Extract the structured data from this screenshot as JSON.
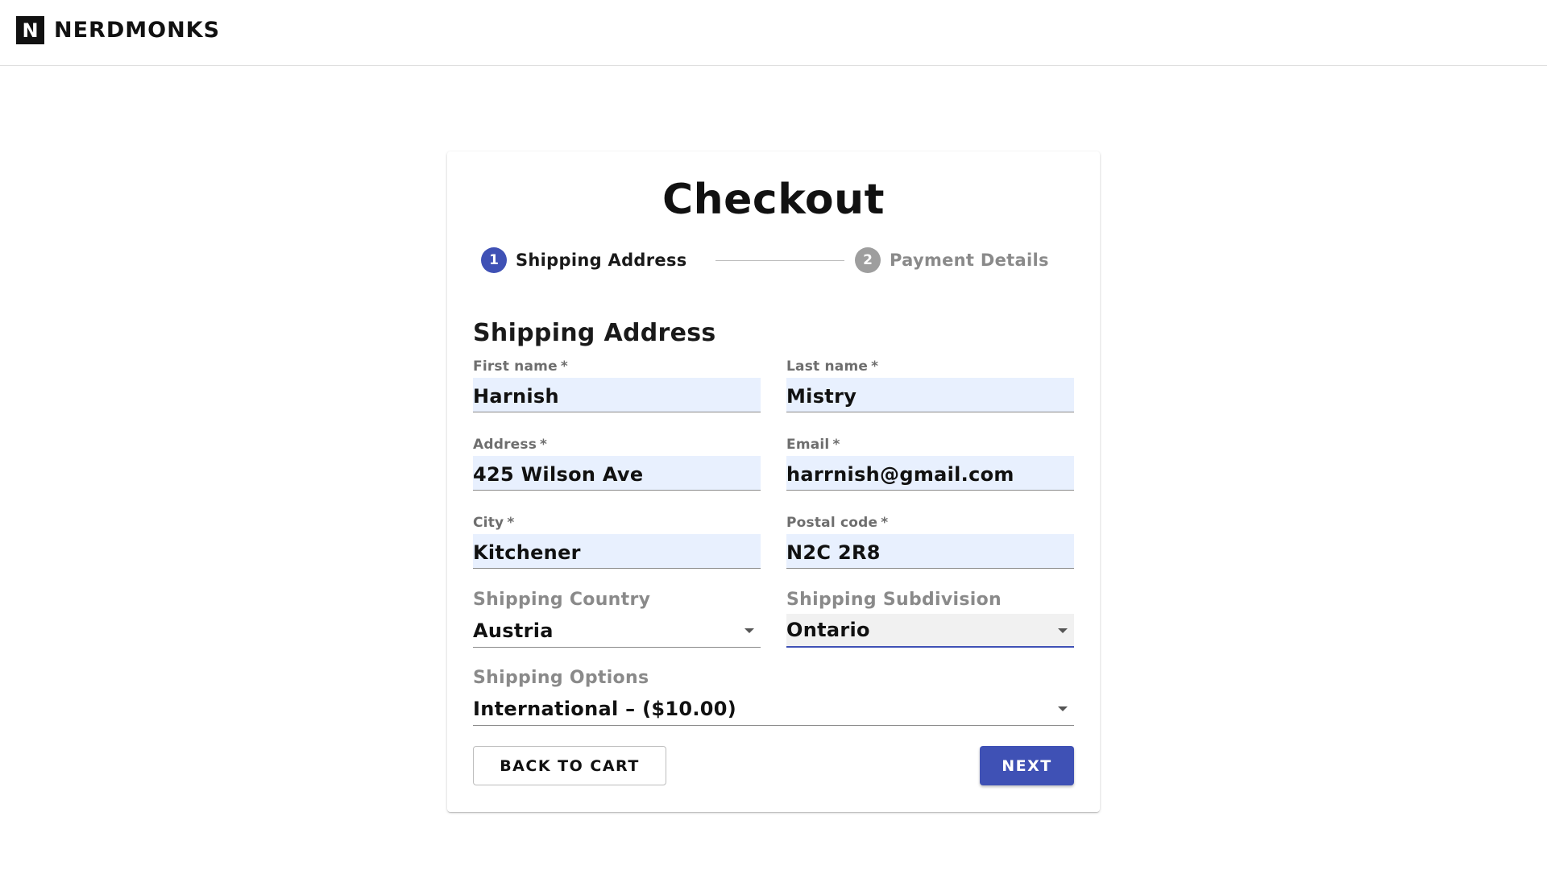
{
  "brand": {
    "logo_letter": "N",
    "name": "NERDMONKS"
  },
  "checkout": {
    "title": "Checkout",
    "steps": [
      {
        "number": "1",
        "label": "Shipping Address",
        "active": true,
        "color": "#3f51b5"
      },
      {
        "number": "2",
        "label": "Payment Details",
        "active": false,
        "color": "#9e9e9e"
      }
    ],
    "section_title": "Shipping Address",
    "fields": {
      "first_name": {
        "label": "First name",
        "required": "*",
        "value": "Harnish"
      },
      "last_name": {
        "label": "Last name",
        "required": "*",
        "value": "Mistry"
      },
      "address": {
        "label": "Address",
        "required": "*",
        "value": "425 Wilson Ave"
      },
      "email": {
        "label": "Email",
        "required": "*",
        "value": "harrnish@gmail.com"
      },
      "city": {
        "label": "City",
        "required": "*",
        "value": "Kitchener"
      },
      "postal_code": {
        "label": "Postal code",
        "required": "*",
        "value": "N2C 2R8"
      }
    },
    "selects": {
      "country": {
        "label": "Shipping Country",
        "value": "Austria"
      },
      "subdivision": {
        "label": "Shipping Subdivision",
        "value": "Ontario"
      },
      "options": {
        "label": "Shipping Options",
        "value": "International – ($10.00)"
      }
    },
    "buttons": {
      "back": "BACK TO CART",
      "next": "NEXT"
    }
  },
  "colors": {
    "primary": "#3f51b5",
    "autofill_bg": "#e8f0fe",
    "inactive": "#9e9e9e"
  }
}
